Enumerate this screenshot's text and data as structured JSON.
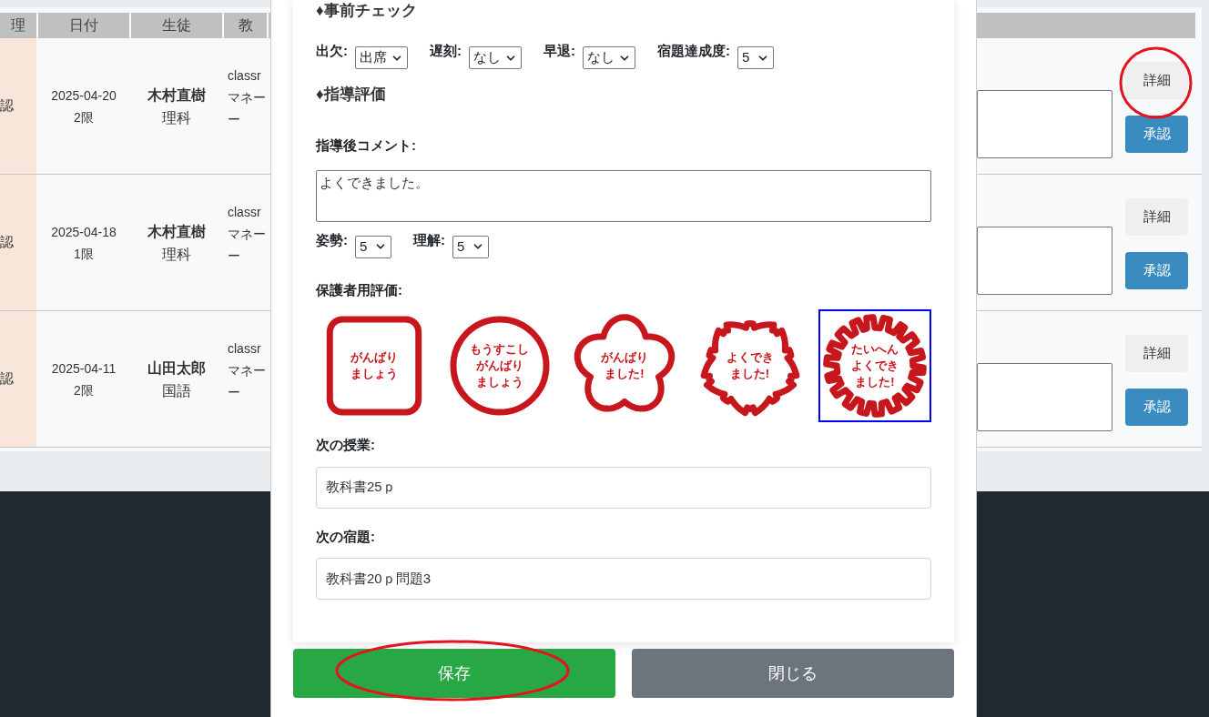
{
  "table": {
    "columns": [
      "理",
      "日付",
      "生徒",
      "教"
    ],
    "rows": [
      {
        "status": "認",
        "date": "2025-04-20",
        "period": "2限",
        "student": "木村直樹",
        "subject": "理科",
        "classroom": [
          "classr",
          "マネー",
          "ー"
        ],
        "detail_button": "詳細",
        "approve_button": "承認"
      },
      {
        "status": "認",
        "date": "2025-04-18",
        "period": "1限",
        "student": "木村直樹",
        "subject": "理科",
        "classroom": [
          "classr",
          "マネー",
          "ー"
        ],
        "detail_button": "詳細",
        "approve_button": "承認"
      },
      {
        "status": "認",
        "date": "2025-04-11",
        "period": "2限",
        "student": "山田太郎",
        "subject": "国語",
        "classroom": [
          "classr",
          "マネー",
          "ー"
        ],
        "detail_button": "詳細",
        "approve_button": "承認"
      }
    ]
  },
  "modal": {
    "pre_check": {
      "heading": "♦事前チェック",
      "selects": [
        {
          "label": "出欠:",
          "value": "出席"
        },
        {
          "label": "遅刻:",
          "value": "なし"
        },
        {
          "label": "早退:",
          "value": "なし"
        },
        {
          "label": "宿題達成度:",
          "value": "5"
        }
      ]
    },
    "evaluation": {
      "heading": "♦指導評価",
      "comment_label": "指導後コメント:",
      "comment": "よくできました。",
      "selects": [
        {
          "label": "姿勢:",
          "value": "5"
        },
        {
          "label": "理解:",
          "value": "5"
        }
      ]
    },
    "parent_evaluation": {
      "label": "保護者用評価:",
      "stamps": [
        {
          "kind": "square",
          "lines": [
            "がんばり",
            "ましょう"
          ],
          "selected": false
        },
        {
          "kind": "circle",
          "lines": [
            "もうすこし",
            "がんばり",
            "ましょう"
          ],
          "selected": false
        },
        {
          "kind": "flower",
          "lines": [
            "がんばり",
            "ました!"
          ],
          "selected": false
        },
        {
          "kind": "blossom",
          "lines": [
            "よくでき",
            "ました!"
          ],
          "selected": false
        },
        {
          "kind": "burst",
          "lines": [
            "たいへん",
            "よくでき",
            "ました!"
          ],
          "selected": true
        }
      ]
    },
    "next_lesson": {
      "label": "次の授業:",
      "value": "教科書25ｐ"
    },
    "next_homework": {
      "label": "次の宿題:",
      "value": "教科書20ｐ問題3"
    },
    "buttons": [
      {
        "kind": "primary",
        "label": "保存"
      },
      {
        "kind": "secondary",
        "label": "閉じる"
      }
    ]
  }
}
